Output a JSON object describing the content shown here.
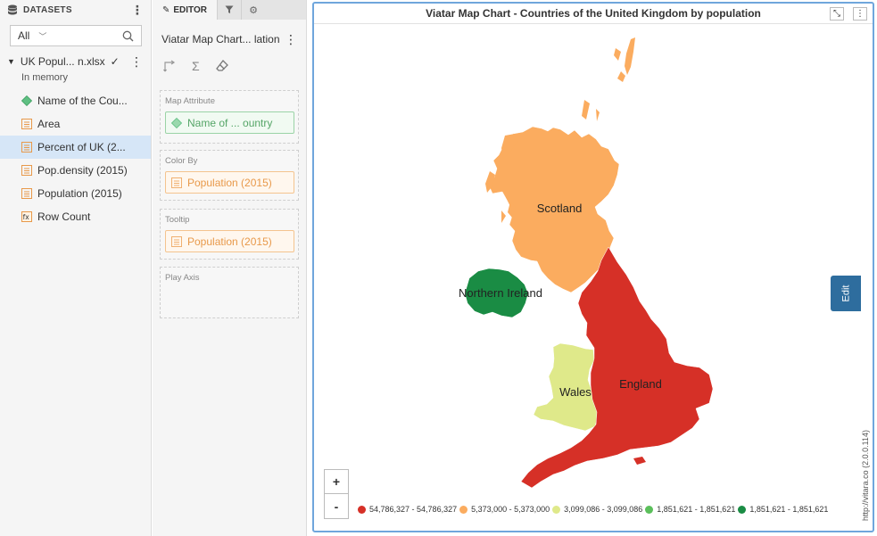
{
  "datasets": {
    "header": "DATASETS",
    "filter_value": "All",
    "file_name": "UK Popul... n.xlsx",
    "file_status": "In memory",
    "items": [
      {
        "label": "Name of the Cou...",
        "icon": "attribute-diamond-icon"
      },
      {
        "label": "Area",
        "icon": "metric-icon"
      },
      {
        "label": "Percent of UK (2...",
        "icon": "metric-icon"
      },
      {
        "label": "Pop.density (2015)",
        "icon": "metric-icon"
      },
      {
        "label": "Population (2015)",
        "icon": "metric-icon"
      },
      {
        "label": "Row Count",
        "icon": "fx-icon"
      }
    ]
  },
  "editor": {
    "tab_label": "EDITOR",
    "viz_name": "Viatar Map Chart... lation",
    "slots": {
      "map_attribute": {
        "label": "Map Attribute",
        "value": "Name of ... ountry"
      },
      "color_by": {
        "label": "Color By",
        "value": "Population (2015)"
      },
      "tooltip": {
        "label": "Tooltip",
        "value": "Population (2015)"
      },
      "play_axis": {
        "label": "Play Axis"
      }
    }
  },
  "chart": {
    "title": "Viatar Map Chart - Countries of the United Kingdom by population",
    "edit_label": "Edit",
    "credit": "http://vitara.co (2.0.0.114)",
    "zoom_in": "+",
    "zoom_out": "-",
    "regions": [
      {
        "name": "Scotland",
        "color": "#fbac5f"
      },
      {
        "name": "Northern Ireland",
        "color": "#1a8c44"
      },
      {
        "name": "Wales",
        "color": "#dfe98a"
      },
      {
        "name": "England",
        "color": "#d63027"
      }
    ],
    "legend": [
      {
        "label": "54,786,327 - 54,786,327",
        "color": "#d63027"
      },
      {
        "label": "5,373,000 - 5,373,000",
        "color": "#fbac5f"
      },
      {
        "label": "3,099,086 - 3,099,086",
        "color": "#dfe98a"
      },
      {
        "label": "1,851,621 - 1,851,621",
        "color": "#5bbf5b"
      },
      {
        "label": "1,851,621 - 1,851,621",
        "color": "#1a8c44"
      }
    ]
  }
}
